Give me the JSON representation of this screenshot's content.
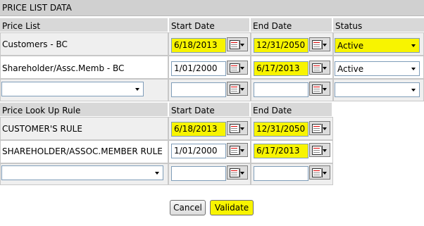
{
  "panel_title": "PRICE LIST DATA",
  "price_list": {
    "headers": {
      "name": "Price List",
      "start": "Start Date",
      "end": "End Date",
      "status": "Status"
    },
    "rows": [
      {
        "name": "Customers - BC",
        "start": "6/18/2013",
        "end": "12/31/2050",
        "status": "Active"
      },
      {
        "name": "Shareholder/Assc.Memb - BC",
        "start": "1/01/2000",
        "end": "6/17/2013",
        "status": "Active"
      },
      {
        "name": "",
        "start": "",
        "end": "",
        "status": ""
      }
    ]
  },
  "lookup_rule": {
    "headers": {
      "name": "Price Look Up Rule",
      "start": "Start Date",
      "end": "End Date"
    },
    "rows": [
      {
        "name": "CUSTOMER'S RULE",
        "start": "6/18/2013",
        "end": "12/31/2050"
      },
      {
        "name": "SHAREHOLDER/ASSOC.MEMBER RULE",
        "start": "1/01/2000",
        "end": "6/17/2013"
      },
      {
        "name": "",
        "start": "",
        "end": ""
      }
    ]
  },
  "buttons": {
    "cancel": "Cancel",
    "validate": "Validate"
  },
  "icons": {
    "calendar": "calendar-picker-icon",
    "dropdown": "chevron-down-icon"
  },
  "colors": {
    "highlight": "#f8f400",
    "header_bg": "#d8d8d8",
    "cell_bg": "#efefef"
  }
}
